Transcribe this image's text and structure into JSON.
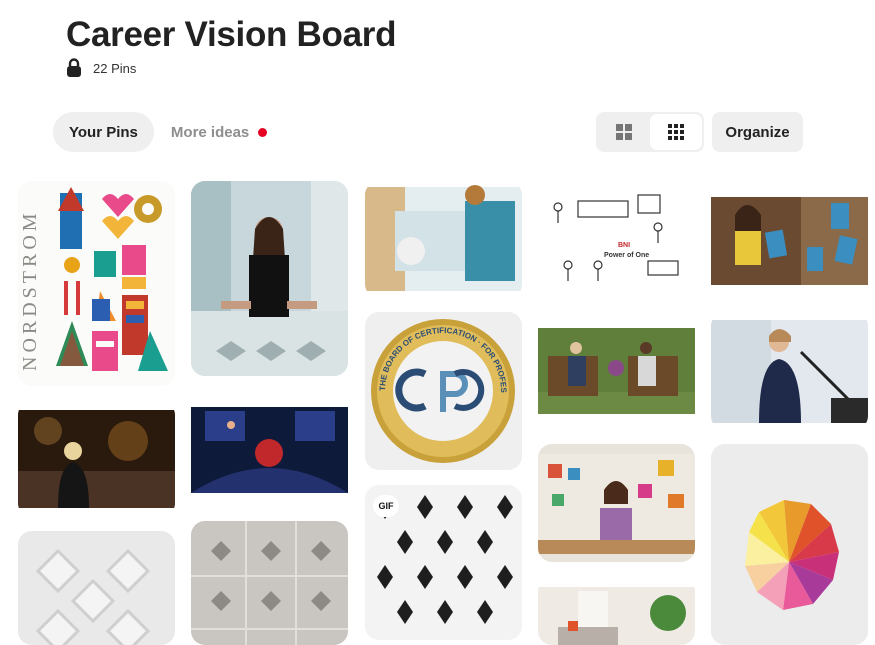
{
  "board": {
    "title": "Career Vision Board",
    "pin_count": "22 Pins",
    "lock_icon": "lock-icon"
  },
  "tabs": {
    "your_pins": "Your Pins",
    "more_ideas": "More ideas"
  },
  "toolbar": {
    "organize": "Organize",
    "view_default": "grid-large-icon",
    "view_compact": "grid-compact-icon"
  },
  "pins": {
    "nordstrom_text": "NORDSTROM",
    "gif_badge": "GIF",
    "seal_text": "THE BOARD OF CERTIFICATION · FOR PROFESSIONAL ORGANIZERS",
    "bni_title": "Power of One",
    "bni_brand": "BNI"
  },
  "colors": {
    "accent_dot": "#e60023",
    "chip_bg": "#efefef",
    "muted_text": "#8e8e8e"
  }
}
